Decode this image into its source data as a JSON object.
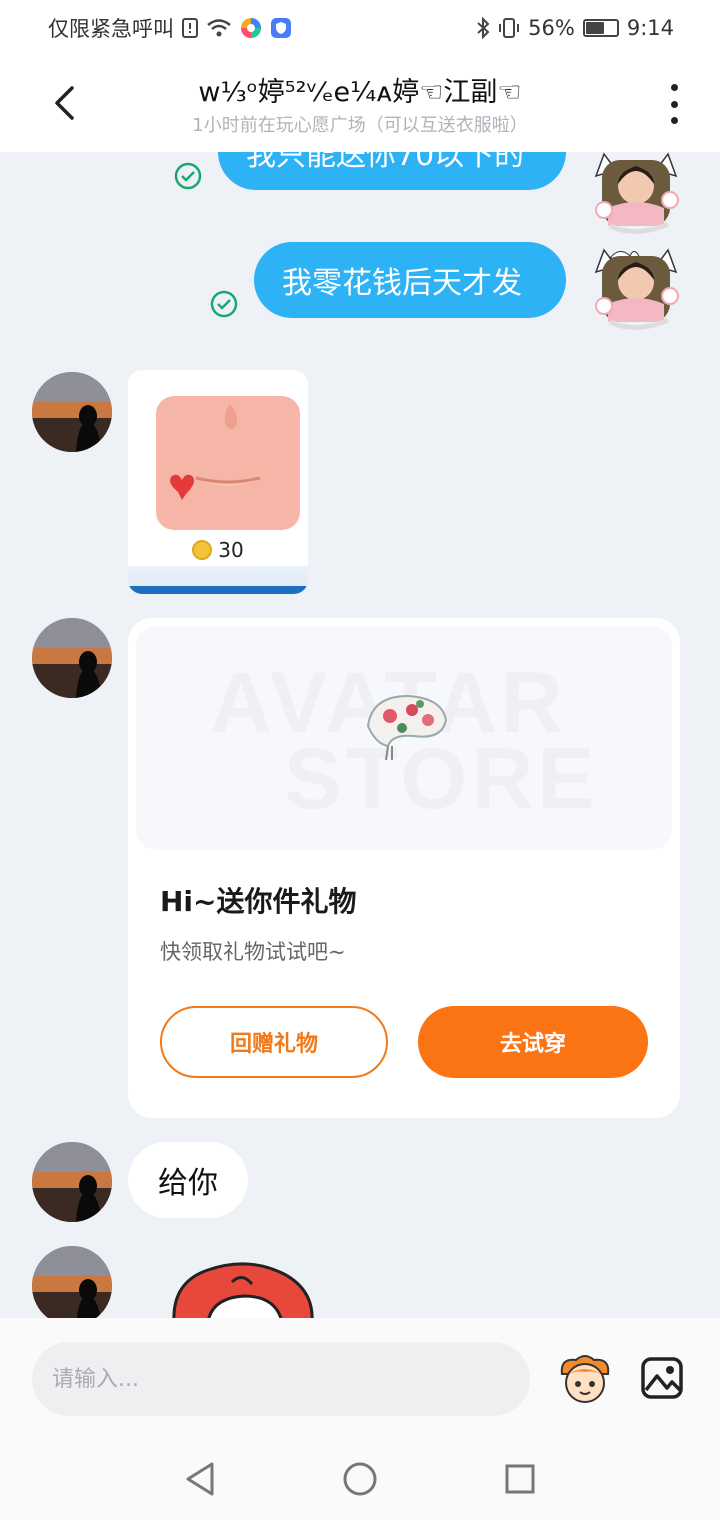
{
  "status_bar": {
    "carrier": "仅限紧急呼叫",
    "battery": "56%",
    "battery_level": 0.56,
    "time": "9:14"
  },
  "header": {
    "title": "ᴡ⅓ᵒ婷⁵²ᵛ⁄ₑe¼ᴀ婷☜江副☜",
    "subtitle": "1小时前在玩心愿广场（可以互送衣服啦）"
  },
  "messages": {
    "out_1": "我只能送你70以下的",
    "out_2": "我零花钱后天才发",
    "gift_thumb_price": "30",
    "gift_card": {
      "watermark_1": "AVATAR",
      "watermark_2": "STORE",
      "title": "Hi~送你件礼物",
      "desc": "快领取礼物试试吧~",
      "return_gift_label": "回赠礼物",
      "try_on_label": "去试穿"
    },
    "in_text": "给你"
  },
  "input": {
    "placeholder": "请输入..."
  },
  "colors": {
    "accent": "#fb7413",
    "bubble_out": "#2cb2f5",
    "check": "#1aa870"
  }
}
